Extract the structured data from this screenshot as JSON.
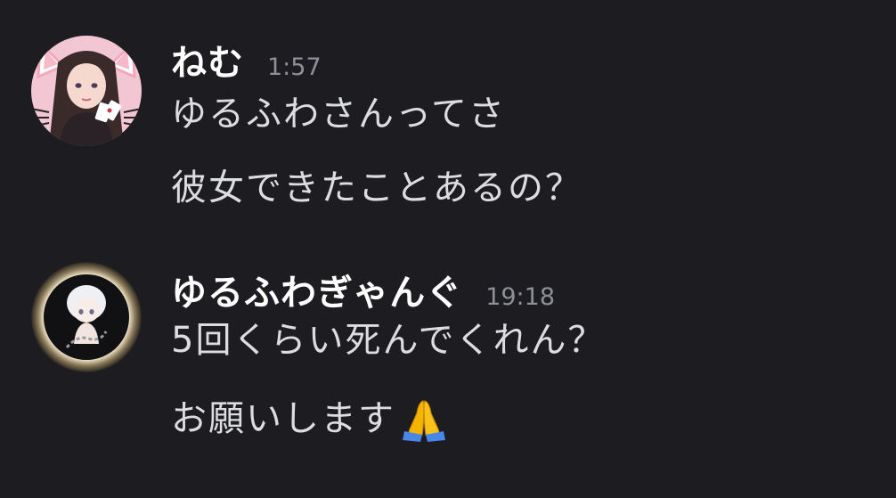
{
  "messages": [
    {
      "username": "ねむ",
      "timestamp": "1:57",
      "avatar_icon": "cat-ear-girl-avatar-icon",
      "lines": [
        "ゆるふわさんってさ",
        "彼女できたことあるの？"
      ]
    },
    {
      "username": "ゆるふわぎゃんぐ",
      "timestamp": "19:18",
      "avatar_icon": "white-hair-chibi-avatar-icon",
      "lines": [
        "5回くらい死んでくれん？",
        "お願いします"
      ],
      "emoji": "folded-hands-emoji"
    }
  ],
  "colors": {
    "background": "#1c1c21",
    "username": "#ffffff",
    "message_text": "#dcdde0",
    "timestamp": "#8e9097",
    "emoji": "#f4b400"
  }
}
